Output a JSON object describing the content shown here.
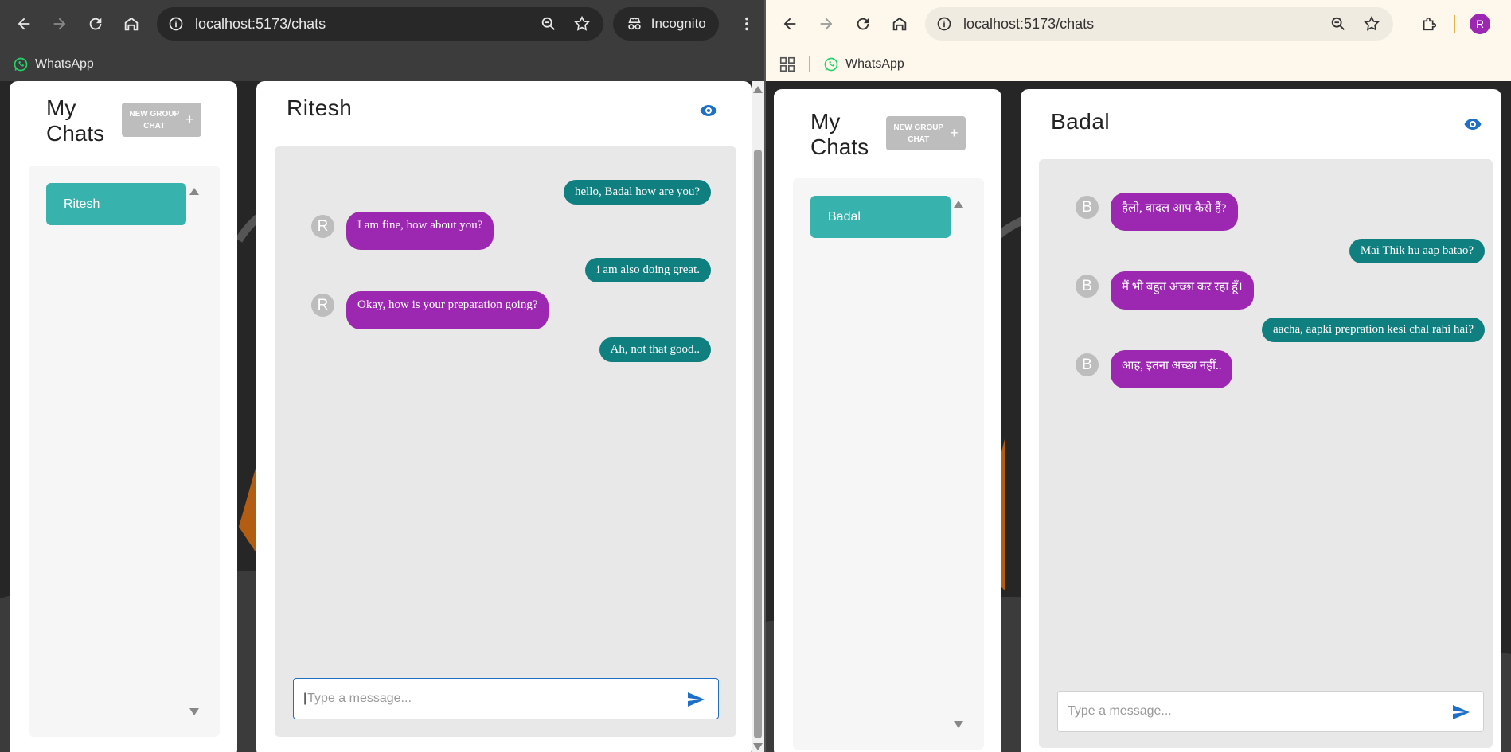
{
  "left_window": {
    "url": "localhost:5173/chats",
    "incognito_label": "Incognito",
    "bookmark": "WhatsApp",
    "sidebar": {
      "title_line1": "My",
      "title_line2": "Chats",
      "new_group_line1": "NEW GROUP",
      "new_group_line2": "CHAT",
      "new_group_plus": "+",
      "chats": [
        {
          "name": "Ritesh"
        }
      ]
    },
    "chat": {
      "name": "Ritesh",
      "avatar_letter": "R",
      "messages": [
        {
          "text": "hello, Badal how are you?",
          "sent": true
        },
        {
          "text": "I am fine, how about you?",
          "sent": false
        },
        {
          "text": "i am also doing great.",
          "sent": true
        },
        {
          "text": "Okay, how is your preparation going?",
          "sent": false
        },
        {
          "text": "Ah, not that good..",
          "sent": true
        }
      ],
      "input_placeholder": "Type a message..."
    }
  },
  "right_window": {
    "url": "localhost:5173/chats",
    "profile_letter": "R",
    "bookmark": "WhatsApp",
    "sidebar": {
      "title_line1": "My",
      "title_line2": "Chats",
      "new_group_line1": "NEW GROUP",
      "new_group_line2": "CHAT",
      "new_group_plus": "+",
      "chats": [
        {
          "name": "Badal"
        }
      ]
    },
    "chat": {
      "name": "Badal",
      "avatar_letter": "B",
      "messages": [
        {
          "text": "हैलो, बादल आप कैसे हैं?",
          "sent": false
        },
        {
          "text": "Mai Thik hu aap batao?",
          "sent": true
        },
        {
          "text": "मैं भी बहुत अच्छा कर रहा हूँ।",
          "sent": false
        },
        {
          "text": "aacha, aapki prepration kesi chal rahi hai?",
          "sent": true
        },
        {
          "text": "आह, इतना अच्छा नहीं..",
          "sent": false
        }
      ],
      "input_placeholder": "Type a message..."
    }
  },
  "colors": {
    "sent_bubble": "#0f7f7f",
    "received_bubble": "#9c27b0",
    "chat_item": "#38b2ac",
    "accent": "#1e6fc8"
  }
}
